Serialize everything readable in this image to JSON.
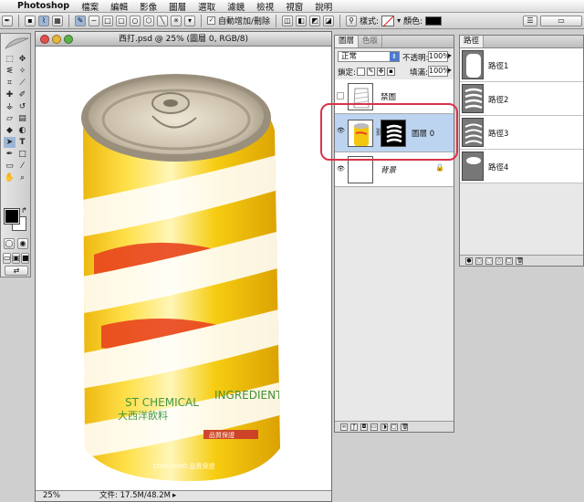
{
  "menubar": {
    "apple": "",
    "app": "Photoshop",
    "items": [
      "檔案",
      "編輯",
      "影像",
      "圖層",
      "選取",
      "濾鏡",
      "檢視",
      "視窗",
      "說明"
    ]
  },
  "options": {
    "auto_add_delete": "自動增加/刪除",
    "style_label": "樣式:",
    "color_label": "顏色:"
  },
  "document": {
    "title": "西打.psd @ 25% (圖層 0, RGB/8)",
    "zoom": "25%",
    "file_info": "文件: 17.5M/48.2M",
    "can_text": {
      "ingredients_a": "ST CHEMICAL",
      "ingredients_b": "INGREDIENTS",
      "chinese_label": "大西洋飲料",
      "small_label": "1001-2000 品質保證",
      "small_label2": "品質保證"
    }
  },
  "layers_panel": {
    "tabs": [
      "圖層",
      "色版"
    ],
    "blend_mode": "正常",
    "opacity_label": "不透明:",
    "opacity": "100%",
    "lock_label": "鎖定:",
    "fill_label": "填滿:",
    "fill": "100%",
    "layers": [
      {
        "name": "禁圖"
      },
      {
        "name": "圖層 0"
      },
      {
        "name": "背景"
      }
    ]
  },
  "paths_panel": {
    "tab": "路徑",
    "paths": [
      {
        "name": "路徑1"
      },
      {
        "name": "路徑2"
      },
      {
        "name": "路徑3"
      },
      {
        "name": "路徑4"
      }
    ]
  },
  "colors": {
    "can_yellow": "#f3c710",
    "accent_red": "#d8344a",
    "selected_layer": "#bcd4f0"
  }
}
